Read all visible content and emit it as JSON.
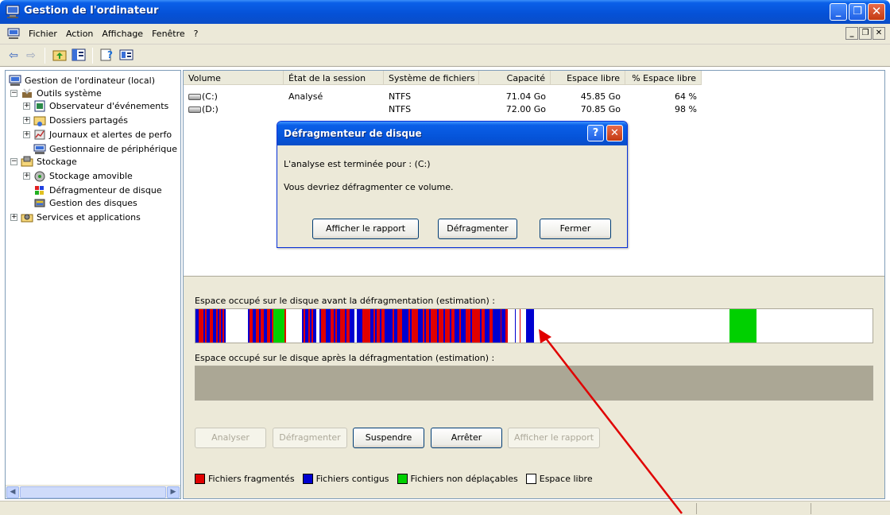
{
  "window": {
    "title": "Gestion de l'ordinateur"
  },
  "menu": {
    "items": [
      "Fichier",
      "Action",
      "Affichage",
      "Fenêtre",
      "?"
    ]
  },
  "tree": {
    "items": [
      {
        "label": "Gestion de l'ordinateur (local)",
        "level": 0,
        "expander": "",
        "icon": "computer-icon"
      },
      {
        "label": "Outils système",
        "level": 1,
        "expander": "−",
        "icon": "tools-icon"
      },
      {
        "label": "Observateur d'événements",
        "level": 2,
        "expander": "+",
        "icon": "event-viewer-icon"
      },
      {
        "label": "Dossiers partagés",
        "level": 2,
        "expander": "+",
        "icon": "shared-folders-icon"
      },
      {
        "label": "Journaux et alertes de perfo",
        "level": 2,
        "expander": "+",
        "icon": "performance-logs-icon"
      },
      {
        "label": "Gestionnaire de périphérique",
        "level": 2,
        "expander": "",
        "icon": "device-manager-icon"
      },
      {
        "label": "Stockage",
        "level": 1,
        "expander": "−",
        "icon": "storage-icon"
      },
      {
        "label": "Stockage amovible",
        "level": 2,
        "expander": "+",
        "icon": "removable-storage-icon"
      },
      {
        "label": "Défragmenteur de disque",
        "level": 2,
        "expander": "",
        "icon": "defragmenter-icon"
      },
      {
        "label": "Gestion des disques",
        "level": 2,
        "expander": "",
        "icon": "disk-management-icon"
      },
      {
        "label": "Services et applications",
        "level": 1,
        "expander": "+",
        "icon": "services-icon"
      }
    ]
  },
  "volumes": {
    "columns": [
      "Volume",
      "État de la session",
      "Système de fichiers",
      "Capacité",
      "Espace libre",
      "% Espace libre"
    ],
    "rows": [
      {
        "volume": "(C:)",
        "state": "Analysé",
        "fs": "NTFS",
        "capacity": "71.04 Go",
        "free": "45.85 Go",
        "pct": "64 %"
      },
      {
        "volume": "(D:)",
        "state": "",
        "fs": "NTFS",
        "capacity": "72.00 Go",
        "free": "70.85 Go",
        "pct": "98 %"
      }
    ]
  },
  "dialog": {
    "title": "Défragmenteur de disque",
    "message1": "L'analyse est terminée pour : (C:)",
    "message2": "Vous devriez défragmenter ce volume.",
    "buttons": {
      "report": "Afficher le rapport",
      "defrag": "Défragmenter",
      "close": "Fermer"
    }
  },
  "lower": {
    "before_label": "Espace occupé sur le disque avant la défragmentation (estimation) :",
    "after_label": "Espace occupé sur le disque après la défragmentation (estimation) :",
    "buttons": {
      "analyze": "Analyser",
      "defrag": "Défragmenter",
      "pause": "Suspendre",
      "stop": "Arrêter",
      "report": "Afficher le rapport"
    }
  },
  "legend": {
    "fragmented": "Fichiers fragmentés",
    "contiguous": "Fichiers contigus",
    "unmovable": "Fichiers non déplaçables",
    "free": "Espace libre"
  },
  "colors": {
    "fragmented": "#e00000",
    "contiguous": "#0000d0",
    "unmovable": "#00d000",
    "free": "#ffffff",
    "annotation_arrow": "#e00000"
  }
}
